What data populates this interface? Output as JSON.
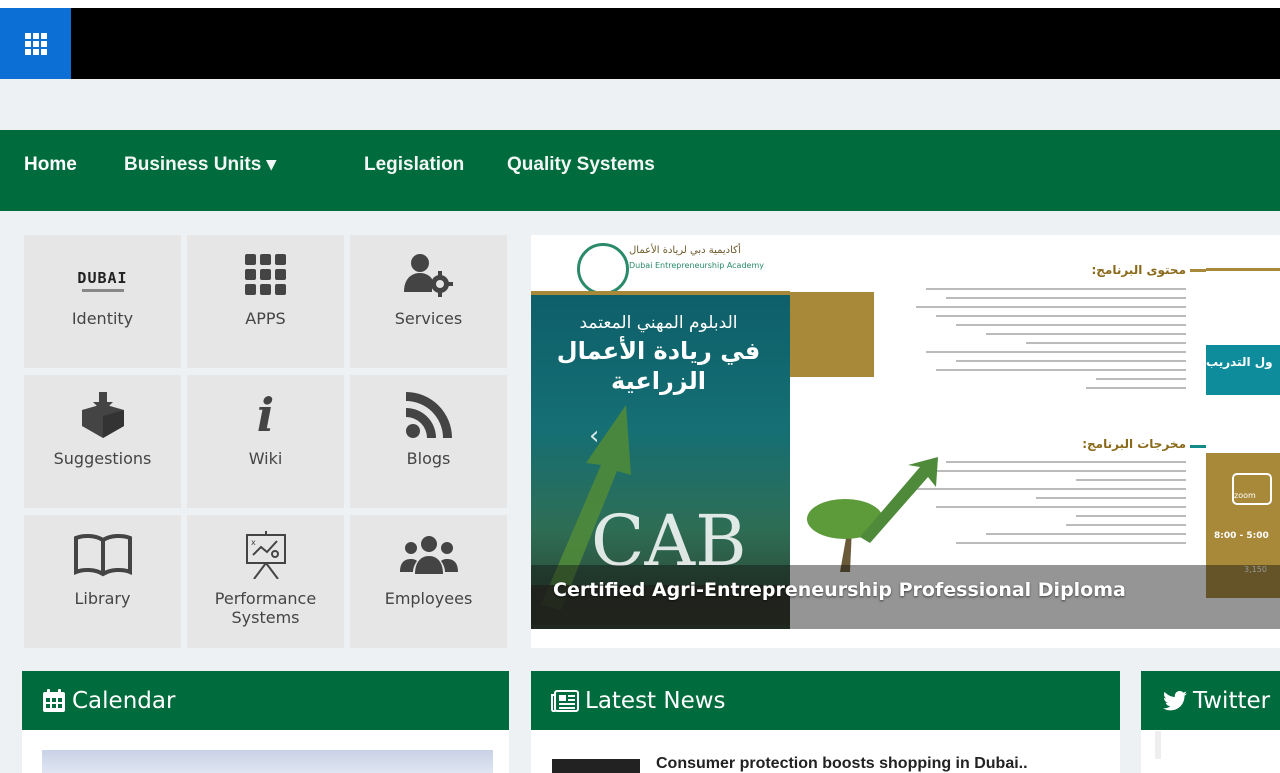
{
  "navbar": {
    "items": [
      {
        "label": "Home"
      },
      {
        "label": "Business Units ▾"
      },
      {
        "label": "Legislation"
      },
      {
        "label": "Quality Systems"
      }
    ]
  },
  "tiles": [
    {
      "label": "Identity",
      "icon": "dubai-logo"
    },
    {
      "label": "APPS",
      "icon": "grid-icon"
    },
    {
      "label": "Services",
      "icon": "user-gear-icon"
    },
    {
      "label": "Suggestions",
      "icon": "box-download-icon"
    },
    {
      "label": "Wiki",
      "icon": "info-icon"
    },
    {
      "label": "Blogs",
      "icon": "rss-icon"
    },
    {
      "label": "Library",
      "icon": "book-icon"
    },
    {
      "label": "Performance Systems",
      "icon": "presentation-board-icon"
    },
    {
      "label": "Employees",
      "icon": "users-icon"
    }
  ],
  "identity_logo_text": "DUBAI",
  "banner": {
    "caption": "Certified Agri-Entrepreneurship Professional Diploma",
    "academy_ar": "أكاديمية دبي لريادة الأعمال",
    "academy_en": "Dubai Entrepreneurship Academy",
    "diploma_ar_1": "الدبلوم المهني المعتمد",
    "diploma_ar_2": "في ريادة الأعمال",
    "diploma_ar_3": "الزراعية",
    "program_content_ar": "محتوى البرنامج:",
    "program_outputs_ar": "مخرجات البرنامج:",
    "training_ar": "ول التدريب",
    "zoom": "zoom",
    "time_text": "8:00 - 5:00",
    "price_text": "3,150"
  },
  "panels": {
    "calendar": {
      "title": "Calendar"
    },
    "news": {
      "title": "Latest News",
      "first_item": "Consumer protection boosts shopping in Dubai.."
    },
    "twitter": {
      "title": "Twitter"
    }
  },
  "colors": {
    "brand_green": "#006b3c",
    "launcher_blue": "#0b6fd6"
  }
}
